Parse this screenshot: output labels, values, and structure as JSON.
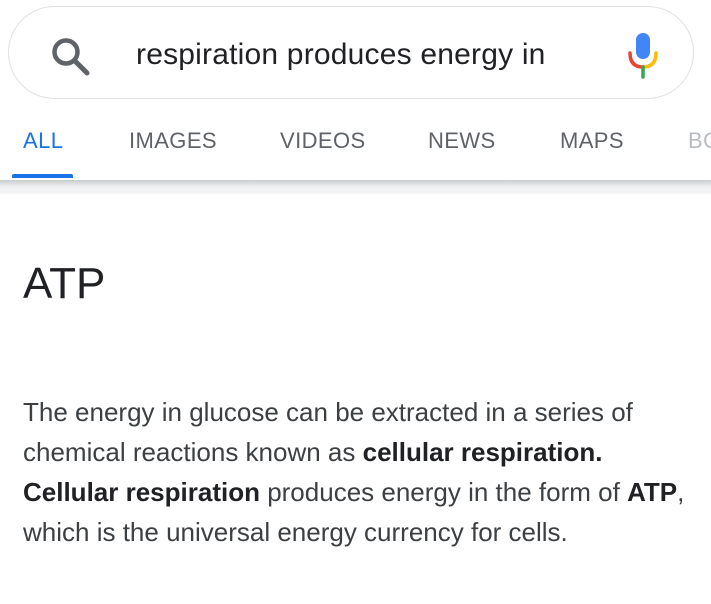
{
  "search": {
    "query": "respiration produces energy in",
    "icons": {
      "search": "search-icon",
      "mic": "mic-icon"
    }
  },
  "tabs": [
    {
      "label": "ALL",
      "active": true
    },
    {
      "label": "IMAGES",
      "active": false
    },
    {
      "label": "VIDEOS",
      "active": false
    },
    {
      "label": "NEWS",
      "active": false
    },
    {
      "label": "MAPS",
      "active": false
    },
    {
      "label": "BO",
      "active": false
    }
  ],
  "colors": {
    "accent": "#1a73e8",
    "text": "#202124",
    "muted": "#5f6368"
  },
  "answer": {
    "title": "ATP",
    "snippet": {
      "p1": "The energy in glucose can be extracted in a series of chemical reactions known as ",
      "b1": "cellular respiration.",
      "p2": " ",
      "b2": "Cellular respiration",
      "p3": " produces energy in the form of ",
      "b3": "ATP",
      "p4": ", which is the universal energy currency for cells."
    }
  }
}
